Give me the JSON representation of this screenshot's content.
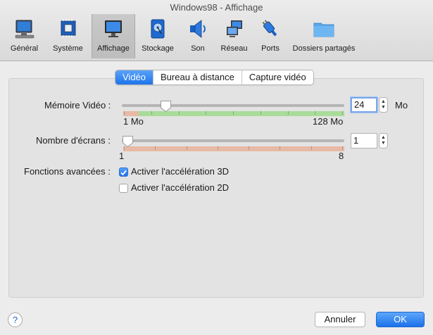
{
  "window": {
    "title": "Windows98 - Affichage"
  },
  "toolbar": {
    "items": [
      {
        "label": "Général",
        "icon": "monitor-general-icon"
      },
      {
        "label": "Système",
        "icon": "chip-icon"
      },
      {
        "label": "Affichage",
        "icon": "display-icon",
        "selected": true
      },
      {
        "label": "Stockage",
        "icon": "disk-icon"
      },
      {
        "label": "Son",
        "icon": "speaker-icon"
      },
      {
        "label": "Réseau",
        "icon": "network-icon"
      },
      {
        "label": "Ports",
        "icon": "plug-icon"
      },
      {
        "label": "Dossiers partagés",
        "icon": "folder-icon"
      }
    ]
  },
  "tabs": [
    {
      "label": "Vidéo",
      "active": true
    },
    {
      "label": "Bureau à distance"
    },
    {
      "label": "Capture vidéo"
    }
  ],
  "video": {
    "memory_label": "Mémoire Vidéo :",
    "memory_value": "24",
    "memory_unit": "Mo",
    "memory_min": "1 Mo",
    "memory_max": "128 Mo",
    "memory_fraction": 0.18,
    "screens_label": "Nombre d'écrans :",
    "screens_value": "1",
    "screens_min": "1",
    "screens_max": "8",
    "screens_fraction": 0.0,
    "advanced_label": "Fonctions avancées :",
    "accel3d_label": "Activer l'accélération 3D",
    "accel3d_checked": true,
    "accel2d_label": "Activer l'accélération 2D",
    "accel2d_checked": false
  },
  "footer": {
    "help_label": "?",
    "cancel_label": "Annuler",
    "ok_label": "OK"
  },
  "colors": {
    "accent": "#1d74ea",
    "range_ok": "#a8dc98",
    "range_warn": "#e8b9a4"
  }
}
